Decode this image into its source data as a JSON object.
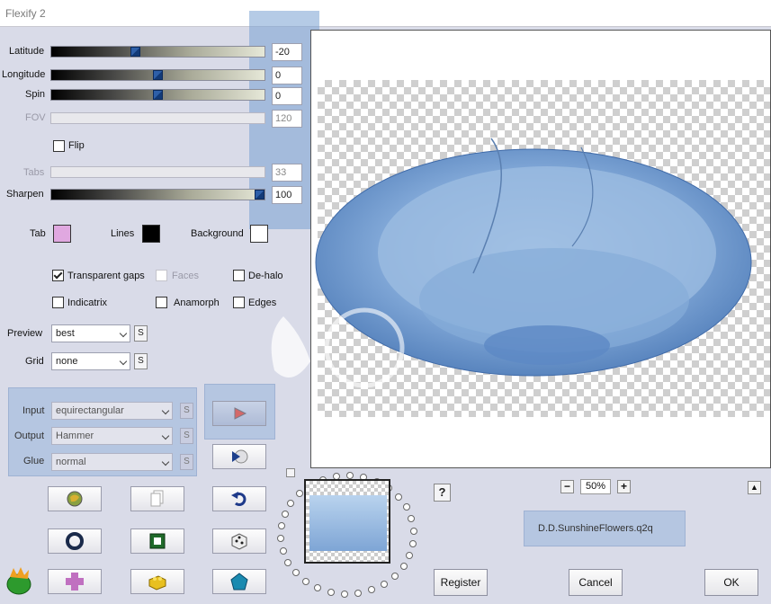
{
  "window": {
    "title": "Flexify 2"
  },
  "sliders": [
    {
      "label": "Latitude",
      "value": "-20",
      "enabled": true,
      "pos": 0.38
    },
    {
      "label": "Longitude",
      "value": "0",
      "enabled": true,
      "pos": 0.5
    },
    {
      "label": "Spin",
      "value": "0",
      "enabled": true,
      "pos": 0.5
    },
    {
      "label": "FOV",
      "value": "120",
      "enabled": false
    },
    {
      "label": "Tabs",
      "value": "33",
      "enabled": false
    },
    {
      "label": "Sharpen",
      "value": "100",
      "enabled": true,
      "pos": 1.0
    }
  ],
  "flip": {
    "label": "Flip",
    "checked": false
  },
  "colors": {
    "tab_label": "Tab",
    "tab_color": "#e0a8e0",
    "lines_label": "Lines",
    "lines_color": "#000000",
    "background_label": "Background",
    "background_color": "#ffffff"
  },
  "options": {
    "transparent_gaps": "Transparent gaps",
    "faces": "Faces",
    "de_halo": "De-halo",
    "indicatrix": "Indicatrix",
    "anamorph": "Anamorph",
    "edges": "Edges"
  },
  "preview_select": {
    "label": "Preview",
    "value": "best",
    "s": "S"
  },
  "grid_select": {
    "label": "Grid",
    "value": "none",
    "s": "S"
  },
  "projection": {
    "input_label": "Input",
    "input_value": "equirectangular",
    "output_label": "Output",
    "output_value": "Hammer",
    "glue_label": "Glue",
    "glue_value": "normal",
    "s": "S"
  },
  "zoom": {
    "minus": "−",
    "value": "50%",
    "plus": "+"
  },
  "help": "?",
  "collapse": "▲",
  "preset_name": "D.D.SunshineFlowers.q2q",
  "buttons": {
    "register": "Register",
    "cancel": "Cancel",
    "ok": "OK"
  },
  "icons": {
    "row1": [
      "globe-icon",
      "copy-icon",
      "undo-icon"
    ],
    "row2": [
      "ring-icon",
      "frame-icon",
      "dice-icon"
    ],
    "row3": [
      "cross-icon",
      "brick-icon",
      "pentagon-icon"
    ]
  }
}
